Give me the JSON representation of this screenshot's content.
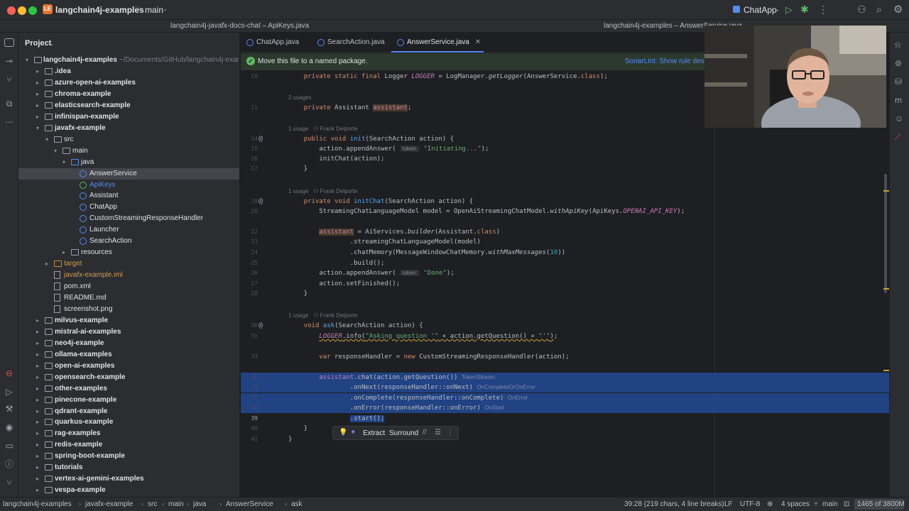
{
  "titlebar": {
    "project_badge": "LE",
    "project_name": "langchain4j-examples",
    "branch": "main",
    "run_config": "ChatApp"
  },
  "pathbar": {
    "left_path": "langchain4j-javafx-docs-chat – ApiKeys.java",
    "right_path": "langchain4j-examples – AnswerService.java"
  },
  "project_panel": {
    "title": "Project",
    "root_label": "langchain4j-examples",
    "root_hint": " ~/Documents/GitHub/langchain4j-examples",
    "rows": [
      {
        "label": ".idea"
      },
      {
        "label": "azure-open-ai-examples"
      },
      {
        "label": "chroma-example"
      },
      {
        "label": "elasticsearch-example"
      },
      {
        "label": "infinispan-example"
      },
      {
        "label": "javafx-example"
      },
      {
        "label": "src"
      },
      {
        "label": "main"
      },
      {
        "label": "java"
      },
      {
        "label": "AnswerService"
      },
      {
        "label": "ApiKeys"
      },
      {
        "label": "Assistant"
      },
      {
        "label": "ChatApp"
      },
      {
        "label": "CustomStreamingResponseHandler"
      },
      {
        "label": "Launcher"
      },
      {
        "label": "SearchAction"
      },
      {
        "label": "resources"
      },
      {
        "label": "target"
      },
      {
        "label": "javafx-example.iml"
      },
      {
        "label": "pom.xml"
      },
      {
        "label": "README.md"
      },
      {
        "label": "screenshot.png"
      },
      {
        "label": "milvus-example"
      },
      {
        "label": "mistral-ai-examples"
      },
      {
        "label": "neo4j-example"
      },
      {
        "label": "ollama-examples"
      },
      {
        "label": "open-ai-examples"
      },
      {
        "label": "opensearch-example"
      },
      {
        "label": "other-examples"
      },
      {
        "label": "pinecone-example"
      },
      {
        "label": "qdrant-example"
      },
      {
        "label": "quarkus-example"
      },
      {
        "label": "rag-examples"
      },
      {
        "label": "redis-example"
      },
      {
        "label": "spring-boot-example"
      },
      {
        "label": "tutorials"
      },
      {
        "label": "vertex-ai-gemini-examples"
      },
      {
        "label": "vespa-example"
      }
    ]
  },
  "tabs": [
    {
      "label": "ChatApp.java"
    },
    {
      "label": "SearchAction.java"
    },
    {
      "label": "AnswerService.java"
    }
  ],
  "banner": {
    "text": "Move this file to a named package.",
    "link": "SonarLint: Show rule descri"
  },
  "editor": {
    "line_numbers": [
      "10",
      "",
      "11",
      "",
      "14",
      "15",
      "16",
      "17",
      "",
      "19",
      "20",
      "",
      "22",
      "23",
      "24",
      "25",
      "26",
      "27",
      "28",
      "",
      "",
      "30",
      "31",
      "32",
      "33",
      "34",
      "35",
      "36",
      "37",
      "38",
      "39",
      "40",
      "41"
    ],
    "hints": {
      "usages": "2 usages",
      "usage_author": "1 usage   ⚇ Frank Delporte"
    },
    "inlay": {
      "token": "token:",
      "token_stream": "TokenStream",
      "on_complete_or_error": "OnCompleteOrOnError",
      "on_error": "OnError",
      "on_start": "OnStart"
    },
    "strings": {
      "initiating": "\"Initiating...\"",
      "done": "\"Done\"",
      "asking": "\"Asking question '\"",
      "quote_end": "\"'\""
    }
  },
  "float_bar": {
    "extract": "Extract",
    "surround": "Surround"
  },
  "statusbar": {
    "crumbs": [
      "langchain4j-examples",
      "javafx-example",
      "src",
      "main",
      "java",
      "AnswerService",
      "ask"
    ],
    "position": "39:28 (219 chars, 4 line breaks)",
    "line_sep": "LF",
    "encoding": "UTF-8",
    "indent": "4 spaces",
    "branch": "main",
    "memory": "1465 of 3800M"
  }
}
